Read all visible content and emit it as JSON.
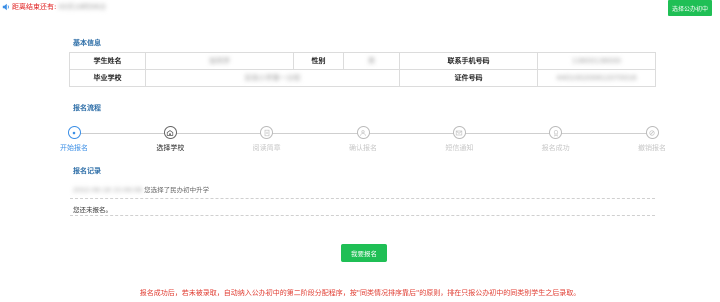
{
  "countdown": {
    "label": "距离结束还有:",
    "value": "00天18时06分"
  },
  "top_button": "选择公办初中",
  "basic_info": {
    "title": "基本信息",
    "rows": [
      [
        {
          "text": "学生姓名",
          "label": true
        },
        {
          "text": "张同学",
          "blur": true
        },
        {
          "text": "性别",
          "label": true
        },
        {
          "text": "男",
          "blur": true
        },
        {
          "text": "联系手机号码",
          "label": true
        },
        {
          "text": "13800138000",
          "blur": true
        }
      ],
      [
        {
          "text": "毕业学校",
          "label": true
        },
        {
          "text": "实验小学第一分校",
          "blur": true,
          "colspan": 3
        },
        {
          "text": "证件号码",
          "label": true
        },
        {
          "text": "440100200812070016",
          "blur": true
        }
      ]
    ]
  },
  "process": {
    "title": "报名流程",
    "steps": [
      {
        "label": "开始报名",
        "state": "active",
        "icon": "play-icon"
      },
      {
        "label": "选择学校",
        "state": "current",
        "icon": "school-icon"
      },
      {
        "label": "阅读简章",
        "state": "pending",
        "icon": "document-icon"
      },
      {
        "label": "确认报名",
        "state": "pending",
        "icon": "user-check-icon"
      },
      {
        "label": "短信通知",
        "state": "pending",
        "icon": "message-icon"
      },
      {
        "label": "报名成功",
        "state": "pending",
        "icon": "badge-icon"
      },
      {
        "label": "撤销报名",
        "state": "pending",
        "icon": "cancel-icon"
      }
    ]
  },
  "records": {
    "title": "报名记录",
    "entries": [
      {
        "time": "2022-06-18 15:06:08",
        "text": "您选择了民办初中升学"
      }
    ],
    "status": "您还未报名。"
  },
  "apply_button": "我要报名",
  "notice": "报名成功后，若未被录取，自动纳入公办初中的第二阶段分配程序，按\"同类情况排序靠后\"的原则，排在只报公办初中的同类别学生之后录取。",
  "colors": {
    "accent_green": "#1fbf55",
    "title_blue": "#2f6fa8",
    "warning_red": "#e03a2f",
    "step_active": "#3a8ee6"
  }
}
